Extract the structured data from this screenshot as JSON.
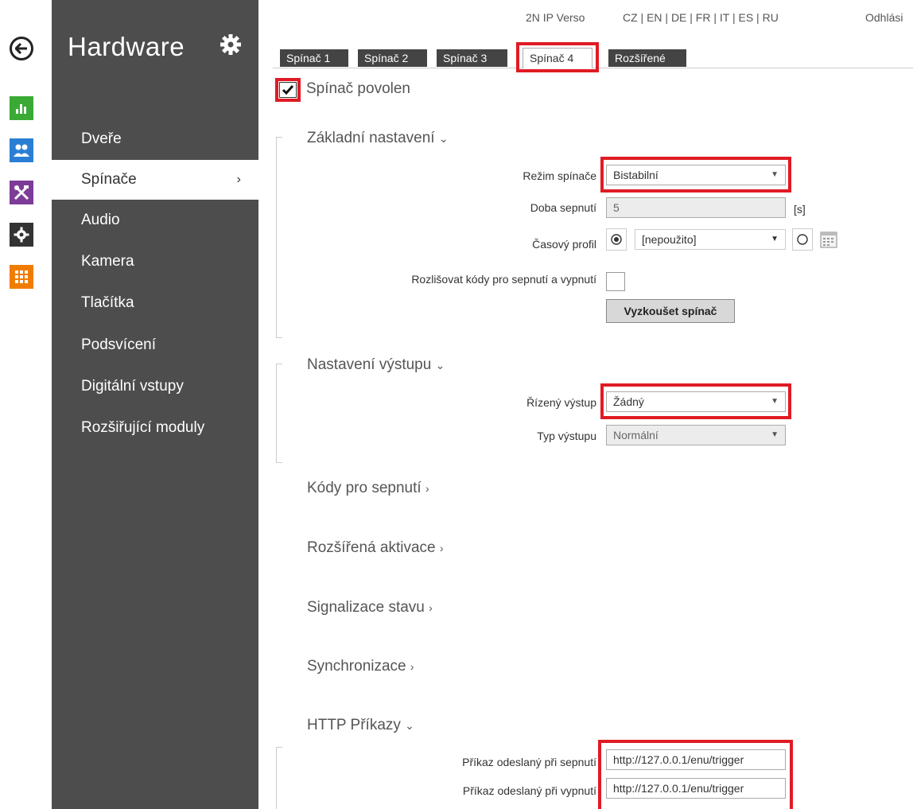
{
  "topbar": {
    "device": "2N IP Verso",
    "languages": "CZ | EN | DE | FR | IT | ES | RU",
    "logout": "Odhlási"
  },
  "sidebar": {
    "title": "Hardware",
    "items": [
      {
        "label": "Dveře"
      },
      {
        "label": "Spínače",
        "chevron": "›"
      },
      {
        "label": "Audio"
      },
      {
        "label": "Kamera"
      },
      {
        "label": "Tlačítka"
      },
      {
        "label": "Podsvícení"
      },
      {
        "label": "Digitální vstupy"
      },
      {
        "label": "Rozšiřující moduly"
      }
    ]
  },
  "rail_icons": [
    "bar-chart-icon",
    "users-icon",
    "tools-icon",
    "gear-icon",
    "grid-icon"
  ],
  "colors": {
    "accent_red": "#e01b24",
    "sidebar_bg": "#4d4d4d",
    "rail_green": "#3aaa35",
    "rail_blue": "#2a7fd4",
    "rail_purple": "#7d3c98",
    "rail_dark": "#333333",
    "rail_orange": "#f07d00"
  },
  "tabs": [
    {
      "label": "Spínač 1"
    },
    {
      "label": "Spínač 2"
    },
    {
      "label": "Spínač 3"
    },
    {
      "label": "Spínač 4",
      "active": true
    },
    {
      "label": "Rozšířené"
    }
  ],
  "enable": {
    "label": "Spínač povolen",
    "checked": true
  },
  "basic": {
    "title": "Základní nastavení",
    "chevron": "⌄",
    "mode_label": "Režim spínače",
    "mode_value": "Bistabilní",
    "duration_label": "Doba sepnutí",
    "duration_value": "5",
    "duration_unit": "[s]",
    "profile_label": "Časový profil",
    "profile_value": "[nepoužito]",
    "distinguish_label": "Rozlišovat kódy pro sepnutí a vypnutí",
    "test_button": "Vyzkoušet spínač"
  },
  "output": {
    "title": "Nastavení výstupu",
    "chevron": "⌄",
    "controlled_label": "Řízený výstup",
    "controlled_value": "Žádný",
    "type_label": "Typ výstupu",
    "type_value": "Normální"
  },
  "collapsed_sections": [
    {
      "title": "Kódy pro sepnutí",
      "chevron": "›"
    },
    {
      "title": "Rozšířená aktivace",
      "chevron": "›"
    },
    {
      "title": "Signalizace stavu",
      "chevron": "›"
    },
    {
      "title": "Synchronizace",
      "chevron": "›"
    }
  ],
  "http": {
    "title": "HTTP Příkazy",
    "chevron": "⌄",
    "on_label": "Příkaz odeslaný při sepnutí",
    "on_value": "http://127.0.0.1/enu/trigger",
    "off_label": "Příkaz odeslaný při vypnutí",
    "off_value": "http://127.0.0.1/enu/trigger"
  }
}
